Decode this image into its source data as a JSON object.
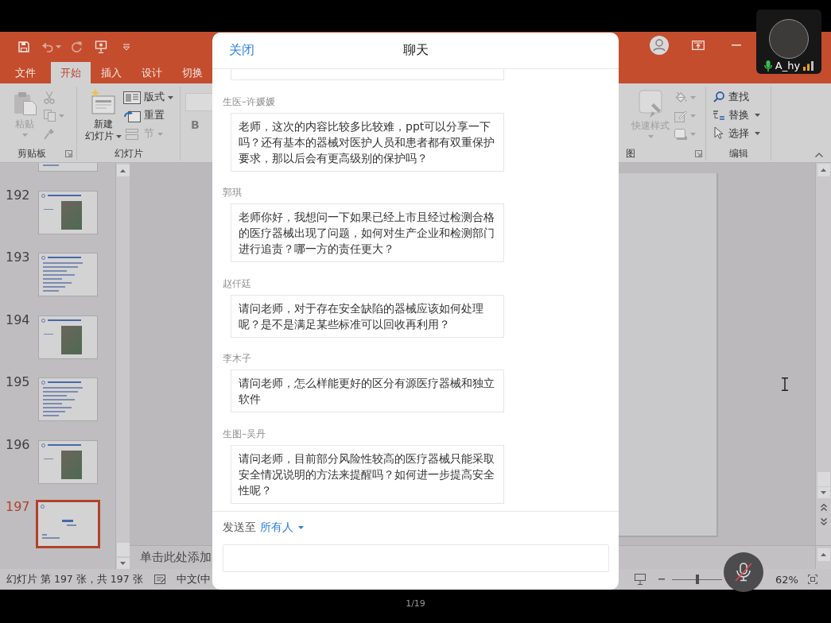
{
  "presentation_app": {
    "tabs": [
      {
        "label": "文件",
        "selected": false
      },
      {
        "label": "开始",
        "selected": true
      },
      {
        "label": "插入",
        "selected": false
      },
      {
        "label": "设计",
        "selected": false
      },
      {
        "label": "切换",
        "selected": false
      }
    ],
    "ribbon": {
      "clipboard": {
        "label": "剪贴板",
        "paste": {
          "label": "粘贴",
          "disabled": true,
          "dropdown": true
        },
        "small_buttons": [
          {
            "disabled": true,
            "dropdown": false
          },
          {
            "disabled": true,
            "dropdown": true
          },
          {
            "disabled": true,
            "dropdown": false
          }
        ]
      },
      "slides": {
        "label": "幻灯片",
        "new_slide": {
          "lines": [
            "新建",
            "幻灯片"
          ],
          "dropdown": true
        },
        "items": [
          {
            "label": "版式",
            "dropdown": true,
            "disabled": false
          },
          {
            "label": "重置",
            "dropdown": false,
            "disabled": false
          },
          {
            "label": "节",
            "dropdown": true,
            "disabled": true
          }
        ]
      },
      "font": {
        "bold": {
          "label": "B",
          "disabled": true
        }
      },
      "drawing": {
        "label": "图",
        "quick_styles": {
          "label": "快速样式",
          "disabled": true,
          "dropdown": true
        },
        "small_buttons": [
          {
            "disabled": true,
            "dropdown": true
          },
          {
            "disabled": true,
            "dropdown": true
          },
          {
            "disabled": true,
            "dropdown": true
          }
        ]
      },
      "editing": {
        "label": "编辑",
        "items": [
          {
            "label": "查找",
            "dropdown": false
          },
          {
            "label": "替换",
            "dropdown": true
          },
          {
            "label": "选择",
            "dropdown": true
          }
        ]
      }
    },
    "slides": [
      {
        "kind": "text",
        "cut_off": true,
        "selected": false
      },
      {
        "number": "192",
        "kind": "photo",
        "cut_off": false,
        "selected": false
      },
      {
        "number": "193",
        "kind": "text",
        "cut_off": false,
        "selected": false
      },
      {
        "number": "194",
        "kind": "photo",
        "cut_off": false,
        "selected": false
      },
      {
        "number": "195",
        "kind": "text",
        "cut_off": false,
        "selected": false
      },
      {
        "number": "196",
        "kind": "photo",
        "cut_off": false,
        "selected": false
      },
      {
        "number": "197",
        "kind": "title",
        "cut_off": false,
        "selected": true
      }
    ],
    "notes": {
      "placeholder": "单击此处添加"
    },
    "status_bar": {
      "slide_info": "幻灯片 第 197 张，共 197 张",
      "language": "中文(中",
      "zoom": {
        "level": 0.5
      },
      "zoom_percent": "62%"
    }
  },
  "chat": {
    "close": "关闭",
    "title": "聊天",
    "messages": [
      {
        "cut_off": true
      },
      {
        "cut_off": false,
        "sender": "生医–许媛媛",
        "text": "老师，这次的内容比较多比较难，ppt可以分享一下吗？还有基本的器械对医护人员和患者都有双重保护要求，那以后会有更高级别的保护吗？"
      },
      {
        "cut_off": false,
        "sender": "郭琪",
        "text": "老师你好，我想问一下如果已经上市且经过检测合格的医疗器械出现了问题，如何对生产企业和检测部门进行追责？哪一方的责任更大？"
      },
      {
        "cut_off": false,
        "sender": "赵仟廷",
        "text": "请问老师，对于存在安全缺陷的器械应该如何处理呢？是不是满足某些标准可以回收再利用？"
      },
      {
        "cut_off": false,
        "sender": "李木子",
        "text": "请问老师，怎么样能更好的区分有源医疗器械和独立软件"
      },
      {
        "cut_off": false,
        "sender": "生图–吴丹",
        "text": "请问老师，目前部分风险性较高的医疗器械只能采取安全情况说明的方法来提醒吗？如何进一步提高安全性呢？"
      }
    ],
    "send_to_label": "发送至",
    "recipient": "所有人"
  },
  "participant_tile": {
    "name": "A_hy",
    "mic_on": true
  },
  "mute_button": {
    "muted": true
  },
  "page_indicator": "1/19"
}
